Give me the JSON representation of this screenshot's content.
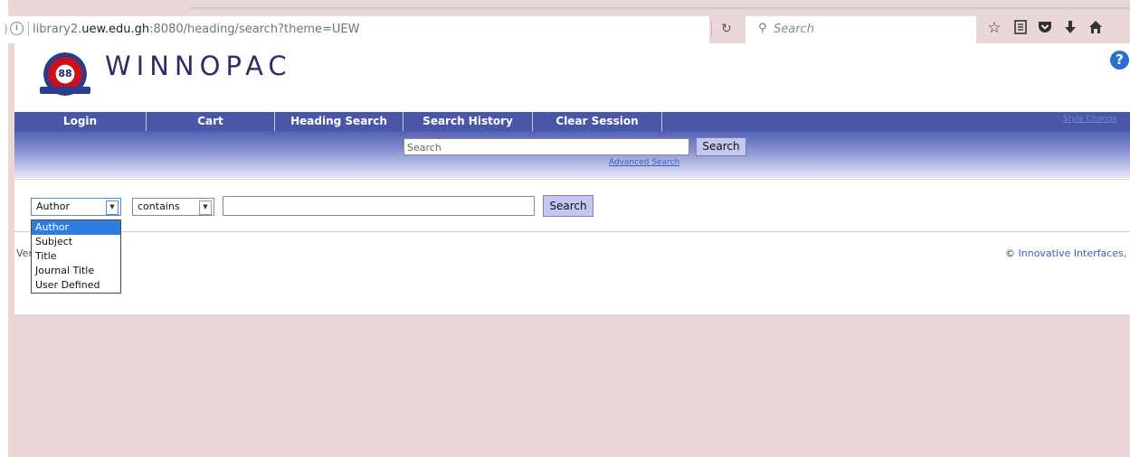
{
  "browser": {
    "url_prefix": "library2.",
    "url_domain": "uew.edu.gh",
    "url_suffix": ":8080/heading/search?theme=UEW",
    "search_placeholder": "Search"
  },
  "header": {
    "logo_text": "WINNOPAC",
    "help_label": "?"
  },
  "nav": {
    "items": [
      {
        "label": "Login"
      },
      {
        "label": "Cart"
      },
      {
        "label": "Heading Search"
      },
      {
        "label": "Search History"
      },
      {
        "label": "Clear Session"
      }
    ],
    "right_link": "Style Change"
  },
  "quick_search": {
    "placeholder": "Search",
    "button": "Search",
    "advanced_link": "Advanced Search"
  },
  "heading_search": {
    "field_value": "Author",
    "operator_value": "contains",
    "term_value": "",
    "button": "Search",
    "field_options": [
      "Author",
      "Subject",
      "Title",
      "Journal Title",
      "User Defined"
    ],
    "selected_option": "Author"
  },
  "footer": {
    "version_text": "Ver",
    "copyright_symbol": "©",
    "copyright_text": "Innovative Interfaces, In"
  },
  "colors": {
    "nav_bg": "#4a56a6",
    "button_bg": "#c3c6ef",
    "link": "#3b5cc4",
    "page_background": "#ead8d8",
    "dropdown_selected": "#2f7de0"
  }
}
